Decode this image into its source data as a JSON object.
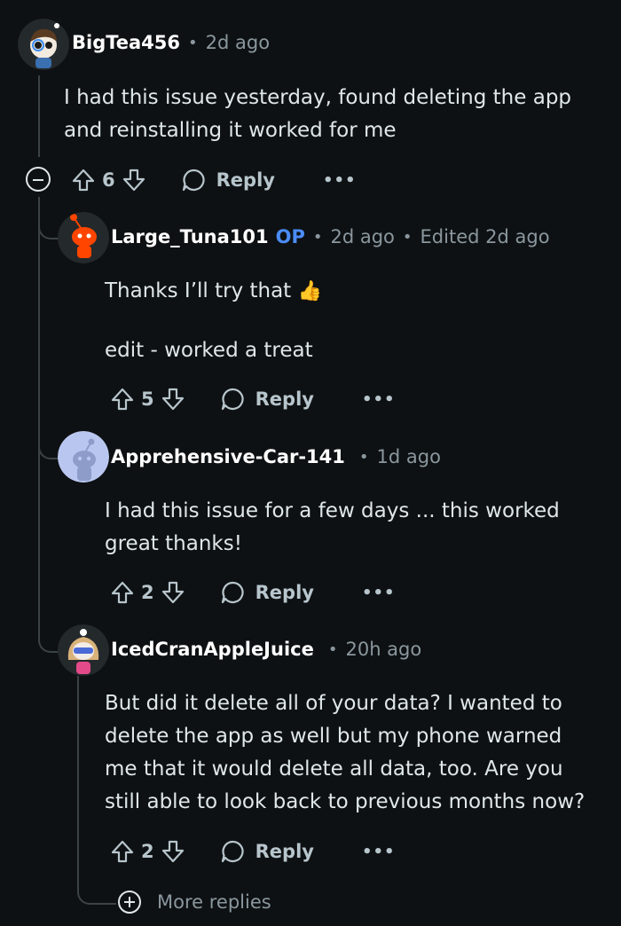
{
  "comments": [
    {
      "username": "BigTea456",
      "time": "2d ago",
      "body": [
        "I had this issue yesterday, found deleting the app",
        "and reinstalling it worked for me"
      ],
      "votes": "6",
      "reply_label": "Reply",
      "more_label": "•••"
    },
    {
      "username": "Large_Tuna101",
      "op_badge": "OP",
      "time": "2d ago",
      "edited": "Edited 2d ago",
      "body": [
        "Thanks I’ll try that",
        "edit - worked a treat"
      ],
      "emoji": "👍",
      "votes": "5",
      "reply_label": "Reply",
      "more_label": "•••"
    },
    {
      "username": "Apprehensive-Car-141",
      "time": "1d ago",
      "body": [
        "I had this issue for a few days ... this worked",
        "great thanks!"
      ],
      "votes": "2",
      "reply_label": "Reply",
      "more_label": "•••"
    },
    {
      "username": "IcedCranAppleJuice",
      "time": "20h ago",
      "body": [
        "But did it delete all of your data? I wanted to",
        "delete the app as well but my phone warned",
        "me that it would delete all data, too. Are you",
        "still able to look back to previous months now?"
      ],
      "votes": "2",
      "reply_label": "Reply",
      "more_label": "•••"
    }
  ],
  "more_replies_label": "More replies",
  "separator": "•",
  "colors": {
    "background": "#0e1113",
    "text": "#dfe7ea",
    "muted": "#8a979e",
    "op": "#4b8cf7",
    "thread_line": "#3b4347"
  }
}
